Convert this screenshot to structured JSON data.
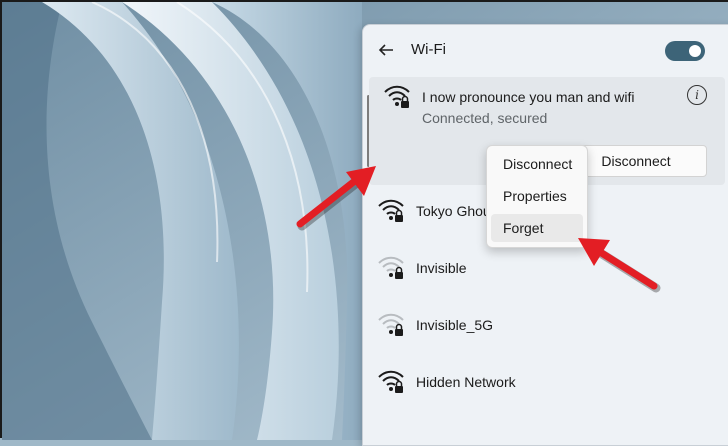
{
  "panel": {
    "title": "Wi-Fi",
    "back_icon": "back-arrow-icon",
    "wifi_toggle_on": true,
    "accent": "#3d6478"
  },
  "connected": {
    "name": "I now pronounce you man and wifi",
    "status": "Connected, secured",
    "disconnect_label": "Disconnect"
  },
  "networks": [
    {
      "name": "Tokyo Ghoul",
      "signal": "strong",
      "secured": true
    },
    {
      "name": "Invisible",
      "signal": "weak",
      "secured": true
    },
    {
      "name": "Invisible_5G",
      "signal": "weak",
      "secured": true
    },
    {
      "name": "Hidden Network",
      "signal": "strong",
      "secured": true
    }
  ],
  "context_menu": {
    "items": [
      "Disconnect",
      "Properties",
      "Forget"
    ],
    "highlighted": "Forget"
  },
  "annotation_color": "#e31e24"
}
